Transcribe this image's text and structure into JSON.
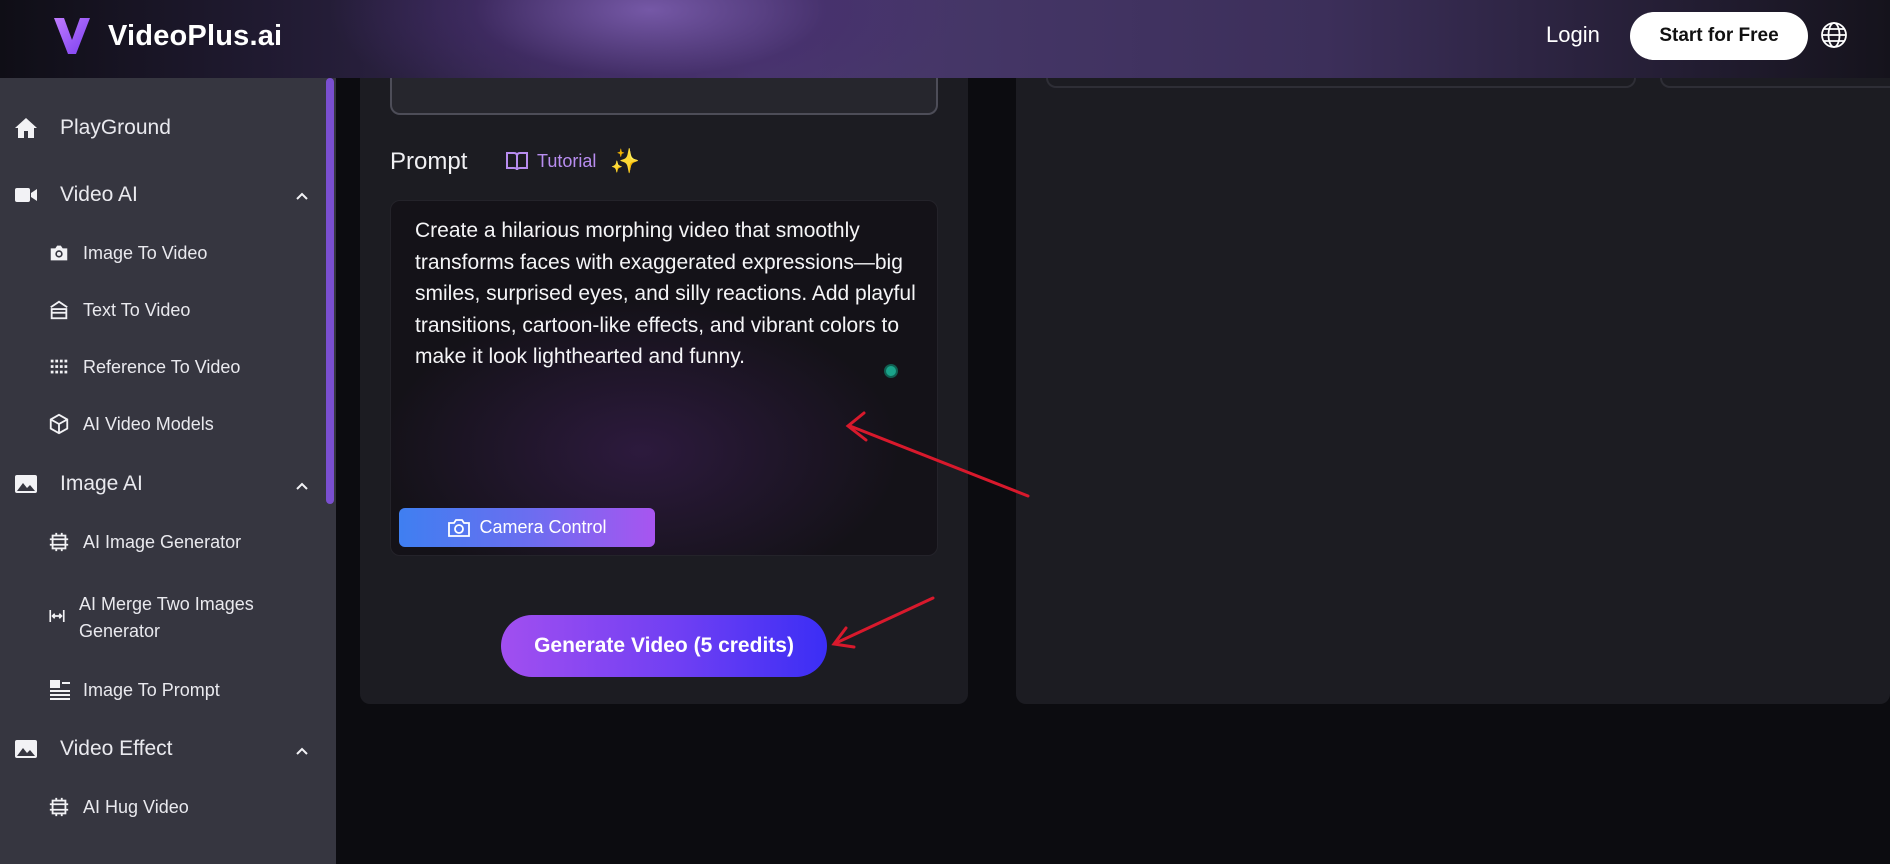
{
  "header": {
    "brand": "VideoPlus.ai",
    "login_label": "Login",
    "start_label": "Start for Free",
    "language_icon": "globe-icon"
  },
  "sidebar": {
    "items": [
      {
        "label": "PlayGround",
        "icon": "home-icon",
        "level": "main"
      },
      {
        "label": "Video AI",
        "icon": "video-camera-icon",
        "level": "main",
        "expanded": true
      },
      {
        "label": "Image To Video",
        "icon": "camera-icon",
        "level": "sub"
      },
      {
        "label": "Text To Video",
        "icon": "text-box-icon",
        "level": "sub"
      },
      {
        "label": "Reference To Video",
        "icon": "dot-grid-icon",
        "level": "sub"
      },
      {
        "label": "AI Video Models",
        "icon": "cube-icon",
        "level": "sub"
      },
      {
        "label": "Image AI",
        "icon": "image-icon",
        "level": "main",
        "expanded": true
      },
      {
        "label": "AI Image Generator",
        "icon": "crop-icon",
        "level": "sub"
      },
      {
        "label": "AI Merge Two Images Generator",
        "label_line1": "AI Merge Two Images",
        "label_line2": "Generator",
        "icon": "merge-icon",
        "level": "sub"
      },
      {
        "label": "Image To Prompt",
        "icon": "image-text-icon",
        "level": "sub"
      },
      {
        "label": "Video Effect",
        "icon": "image-icon",
        "level": "main",
        "expanded": true
      },
      {
        "label": "AI Hug Video",
        "icon": "crop-icon",
        "level": "sub"
      }
    ]
  },
  "editor": {
    "prompt_label": "Prompt",
    "tutorial_label": "Tutorial",
    "prompt_text": "Create a hilarious morphing video that smoothly transforms faces with exaggerated expressions—big smiles, surprised eyes, and silly reactions. Add playful transitions, cartoon-like effects, and vibrant colors to make it look lighthearted and funny.",
    "camera_control_label": "Camera Control",
    "generate_label": "Generate Video (5 credits)"
  },
  "colors": {
    "accent_purple": "#a855f0",
    "sidebar_bg": "#363640",
    "panel_bg": "#1c1c22",
    "annotation_red": "#d8192c"
  }
}
